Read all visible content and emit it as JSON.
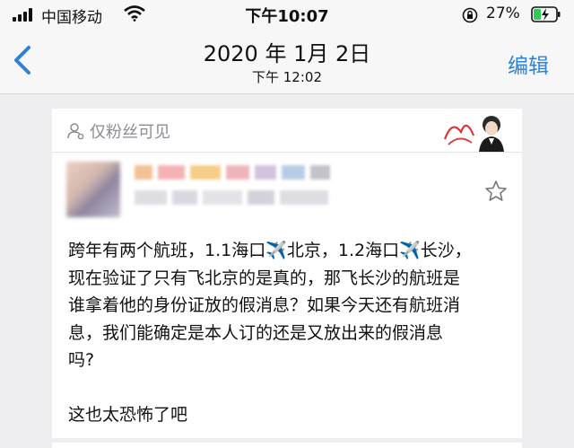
{
  "status_bar": {
    "carrier": "中国移动",
    "time": "下午10:07",
    "battery_percent": "27%"
  },
  "nav": {
    "back_icon": "chevron-left-icon",
    "title": "2020 年 1月 2日",
    "subtitle": "下午 12:02",
    "edit_label": "编辑"
  },
  "post": {
    "visibility": "仅粉丝可见",
    "lines": [
      "跨年有两个航班，1.1海口✈️北京，1.2海口✈️长沙，",
      "现在验证了只有飞北京的是真的，那飞长沙的航班是",
      "谁拿着他的身份证放的假消息？如果今天还有航班消",
      "息，我们能确定是本人订的还是又放出来的假消息",
      "吗?"
    ],
    "closing": "这也太恐怖了吧"
  },
  "colors": {
    "accent": "#2d82d6",
    "muted_text": "#8c8c94",
    "plane_emoji": "#5aa6e6"
  }
}
